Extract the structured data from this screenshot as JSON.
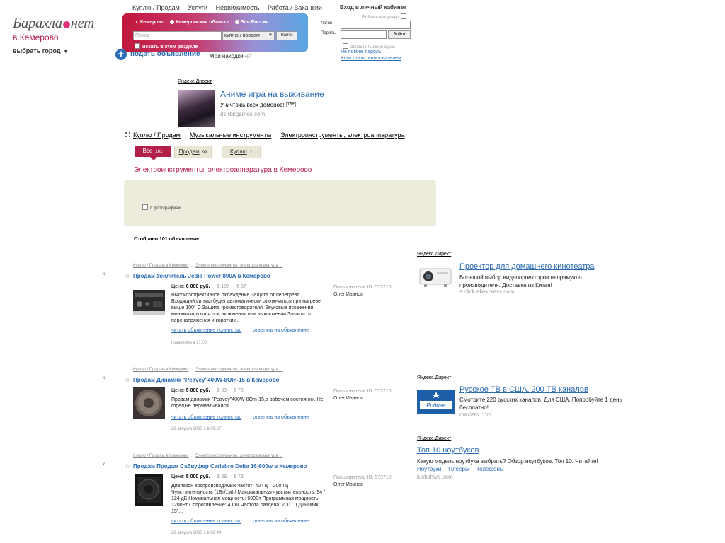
{
  "logo": {
    "part1": "Барахла",
    "part2": "нет",
    "city": "в Кемерово",
    "choose_city": "выбрать город",
    "choose_caret": "▼"
  },
  "topnav": [
    "Куплю / Продам",
    "Услуги",
    "Недвижимость",
    "Работа / Вакансии"
  ],
  "search": {
    "regions": [
      "Кемерово",
      "Кемеровская область",
      "Вся Россия"
    ],
    "placeholder": "Поиск",
    "select": "куплю / продам",
    "button": "Найти",
    "in_section": "искать в этом разделе"
  },
  "post_ad": {
    "plus": "+",
    "label": "подать объявление"
  },
  "my_finds": {
    "label": "Мои находки",
    "suffix": "нет"
  },
  "login": {
    "title": "Вход в  личный кабинет",
    "partner": "Войти как партнер",
    "login_label": "Логин",
    "password_label": "Пароль",
    "button": "Войти",
    "remember": "Запомнить меня здесь",
    "forgot": "Не помню пароль",
    "register": "Хочу стать пользователем"
  },
  "top_ad": {
    "label": "Яндекс.Директ",
    "title": "Аниме игра на выживание",
    "text": "Уничтожь всех демонов!",
    "age": "18+",
    "domain": "ds.rbkgames.com"
  },
  "breadcrumb": [
    "Куплю / Продам",
    "Музыкальные инструменты",
    "Электроинструменты, электроаппаратура"
  ],
  "breadcrumb_sep": "→",
  "tabs": [
    {
      "label": "Все",
      "count": "101"
    },
    {
      "label": "Продам",
      "count": "99"
    },
    {
      "label": "Куплю",
      "count": "2"
    }
  ],
  "section_title": "Электроинструменты, электроаппаратура в Кемерово",
  "filter": {
    "with_photo": "с фотографией"
  },
  "found": "Отобрано 101 объявление",
  "listings": [
    {
      "bc1": "Куплю / Продам в Кемерово",
      "bc2": "Электроинструменты, электроаппаратура ...",
      "title": "Продам Усилитель Jedia Power 800A в Кемерово",
      "price_label": "Цена:",
      "price": "6 000 руб.",
      "usd": "$ 107",
      "eur": "€ 87",
      "desc": "Высокоэффективное охлаждение Защита от перегрева. Входящий сигнал будет автоматически отключаться при нагреве выше 100° С Защита громкоговорителя. Звуковые искажения минимизируются при включении или выключении Защита от перенапряжения и коротких...",
      "read": "читать объявление полностью",
      "reply": "ответить на объявление",
      "date": "позавчера в 17:00",
      "uid": "Пользователь ID: 573710",
      "uname": "Олег Иванов"
    },
    {
      "bc1": "Куплю / Продам в Кемерово",
      "bc2": "Электроинструменты, электроаппаратура ...",
      "title": "Продам Динамик \"Peavey\"400W-8Om-15 в Кемерово",
      "price_label": "Цена:",
      "price": "5 000 руб.",
      "usd": "$ 89",
      "eur": "€ 73",
      "desc": "Продам динамик \"Peavey\"400W-8Om-15,в рабочем состоянии. Не горел,не перематывался....",
      "read": "читать объявление полностью",
      "reply": "ответить на объявление",
      "date": "28 августа 2015 г. в 09:27",
      "uid": "Пользователь ID: 573710",
      "uname": "Олег Иванов"
    },
    {
      "bc1": "Куплю / Продам в Кемерово",
      "bc2": "Электроинструменты, электроаппаратура ...",
      "title": "Продам Продам Сабвуфер Carlsbro Delta 16-600w в Кемерово",
      "price_label": "Цена:",
      "price": "5 000 руб.",
      "usd": "$ 89",
      "eur": "€ 73",
      "desc": "Диапазон воспроизводимых частот: 40 Гц – 200 Гц Чувствительность (1Вт/1м) / Максимальная чувствительность: 94 / 124 дБ Номинальная мощность: 600Вт Программная мощность: 1200Вт Сопротивление: 4 Ом Частота раздела: 200 Гц Динамик 15\"...",
      "read": "читать объявление полностью",
      "reply": "ответить на объявление",
      "date": "28 августа 2015 г. в 08:44",
      "uid": "Пользователь ID: 573710",
      "uname": "Олег Иванов"
    }
  ],
  "close_glyph": "×",
  "star_glyph": "☆",
  "right_ads": [
    {
      "label": "Яндекс.Директ",
      "title": "Проектор для домашнего кинотеатра",
      "text": "Большой выбор видеопроекторов напрямую от производителя. Доставка из Китая!",
      "domain": "s.click.aliexpress.com"
    },
    {
      "label": "Яндекс.Директ",
      "title": "Русское ТВ в США. 200 ТВ каналов",
      "text": "Смотрите 220 русских каналов. Для США. Попробуйте 1 день бесплатно!",
      "domain": "maxisto.com",
      "logo_text": "Родина"
    },
    {
      "label": "Яндекс.Директ",
      "title": "Топ 10 ноутбуков",
      "text": "Какую модель ноутбука выбрать? Обзор ноутбуков. Топ 10. Читайте!",
      "sitelinks": [
        "Ноутбуки",
        "Плееры",
        "Телефоны"
      ],
      "domain": "luchshiye.com"
    }
  ]
}
